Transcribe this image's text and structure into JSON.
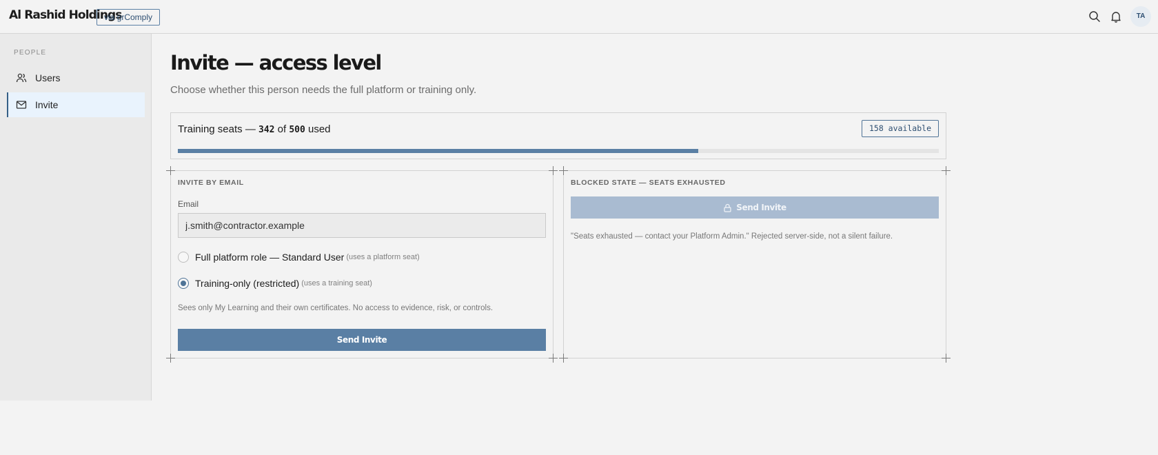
{
  "header": {
    "brand": "Al Rashid Holdings",
    "via_badge": "via grComply",
    "icons": [
      "search-icon",
      "bell-icon"
    ],
    "avatar_initials": "TA"
  },
  "sidebar": {
    "section_label": "PEOPLE",
    "items": [
      {
        "label": "Users",
        "icon": "users-icon",
        "active": false
      },
      {
        "label": "Invite",
        "icon": "mail-icon",
        "active": true
      }
    ]
  },
  "page": {
    "title": "Invite — access level",
    "subtitle": "Choose whether this person needs the full platform or training only."
  },
  "seats": {
    "prefix": "Training seats — ",
    "used": "342",
    "of": " of ",
    "total": "500",
    "suffix": " used",
    "available_badge": "158 available",
    "used_fraction": 0.684
  },
  "invite_panel": {
    "heading": "INVITE BY EMAIL",
    "email_label": "Email",
    "email_value": "j.smith@contractor.example",
    "options": [
      {
        "label": "Full platform role — Standard User",
        "hint": "(uses a platform seat)",
        "checked": false
      },
      {
        "label": "Training-only (restricted)",
        "hint": "(uses a training seat)",
        "checked": true
      }
    ],
    "help_text": "Sees only My Learning and their own certificates. No access to evidence, risk, or controls.",
    "send_label": "Send Invite"
  },
  "blocked_panel": {
    "heading": "BLOCKED STATE — SEATS EXHAUSTED",
    "send_label": "Send Invite",
    "icon": "lock-icon",
    "note": "\"Seats exhausted — contact your Platform Admin.\" Rejected server-side, not a silent failure."
  },
  "colors": {
    "accent": "#5a7fa4",
    "accent_dark": "#2e4f72",
    "disabled_button": "#a9bbd1",
    "active_nav_bg": "#e9f3fd"
  }
}
